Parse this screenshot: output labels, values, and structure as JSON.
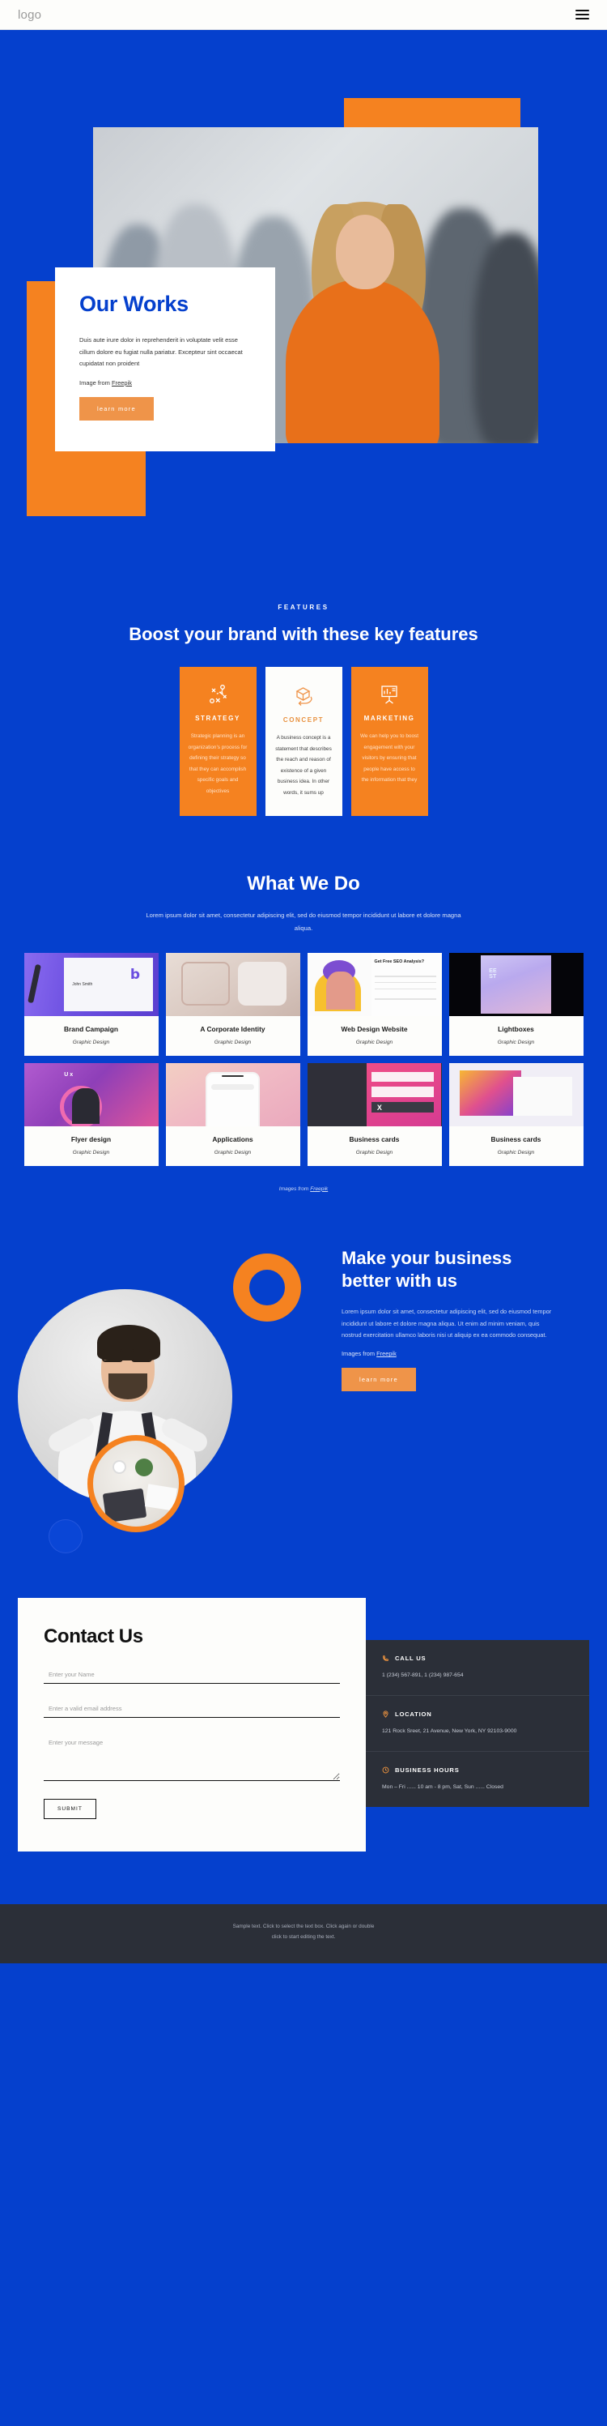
{
  "header": {
    "logo": "logo",
    "menu_icon": "hamburger-menu-icon"
  },
  "hero": {
    "title": "Our Works",
    "body": "Duis aute irure dolor in reprehenderit in voluptate velit esse cillum dolore eu fugiat nulla pariatur. Excepteur sint occaecat cupidatat non proident",
    "credit_prefix": "Image from ",
    "credit_link": "Freepik",
    "button": "learn more"
  },
  "features": {
    "eyebrow": "FEATURES",
    "title": "Boost your brand with these key features",
    "cards": [
      {
        "icon": "strategy-icon",
        "name": "STRATEGY",
        "text": "Strategic planning is an organization’s process for defining their strategy so that they can accomplish specific goals and objectives"
      },
      {
        "icon": "concept-cube-icon",
        "name": "CONCEPT",
        "text": "A business concept is a statement that describes the reach and reason of existence of a given business idea. In other words, it sums up"
      },
      {
        "icon": "marketing-presentation-icon",
        "name": "MARKETING",
        "text": "We can help you to boost engagement with your visitors by ensuring that people have access to the information that they"
      }
    ]
  },
  "works": {
    "title": "What We Do",
    "lede": "Lorem ipsum dolor sit amet, consectetur adipiscing elit, sed do eiusmod tempor incididunt ut labore et dolore magna aliqua.",
    "items": [
      {
        "title": "Brand Campaign",
        "sub": "Graphic Design"
      },
      {
        "title": "A Corporate Identity",
        "sub": "Graphic Design"
      },
      {
        "title": "Web Design Website",
        "sub": "Graphic Design"
      },
      {
        "title": "Lightboxes",
        "sub": "Graphic Design"
      },
      {
        "title": "Flyer design",
        "sub": "Graphic Design"
      },
      {
        "title": "Applications",
        "sub": "Graphic Design"
      },
      {
        "title": "Business cards",
        "sub": "Graphic Design"
      },
      {
        "title": "Business cards",
        "sub": "Graphic Design"
      }
    ],
    "credit_prefix": "Images from ",
    "credit_link": "Freepik"
  },
  "about": {
    "title": "Make your business better with us",
    "body": "Lorem ipsum dolor sit amet, consectetur adipiscing elit, sed do eiusmod tempor incididunt ut labore et dolore magna aliqua. Ut enim ad minim veniam, quis nostrud exercitation ullamco laboris nisi ut aliquip ex ea commodo consequat.",
    "credit_prefix": "Images from ",
    "credit_link": "Freepik",
    "button": "learn more"
  },
  "contact": {
    "title": "Contact Us",
    "name_placeholder": "Enter your Name",
    "email_placeholder": "Enter a valid email address",
    "message_placeholder": "Enter your message",
    "submit": "SUBMIT",
    "info": [
      {
        "icon": "phone-icon",
        "label": "CALL US",
        "lines": [
          "1 (234) 567-891, 1 (234) 987-654"
        ]
      },
      {
        "icon": "pin-icon",
        "label": "LOCATION",
        "lines": [
          "121 Rock Sreet, 21 Avenue, New York, NY 92103-9000"
        ]
      },
      {
        "icon": "clock-icon",
        "label": "BUSINESS HOURS",
        "lines": [
          "Mon – Fri ...... 10 am - 8 pm, Sat, Sun ...... Closed"
        ]
      }
    ]
  },
  "footer": {
    "line1": "Sample text. Click to select the text box. Click again or double",
    "line2": "click to start editing the text."
  },
  "colors": {
    "blue": "#0540cd",
    "orange": "#f58220",
    "orange_soft": "#ef9449",
    "dark": "#2b2f38"
  }
}
